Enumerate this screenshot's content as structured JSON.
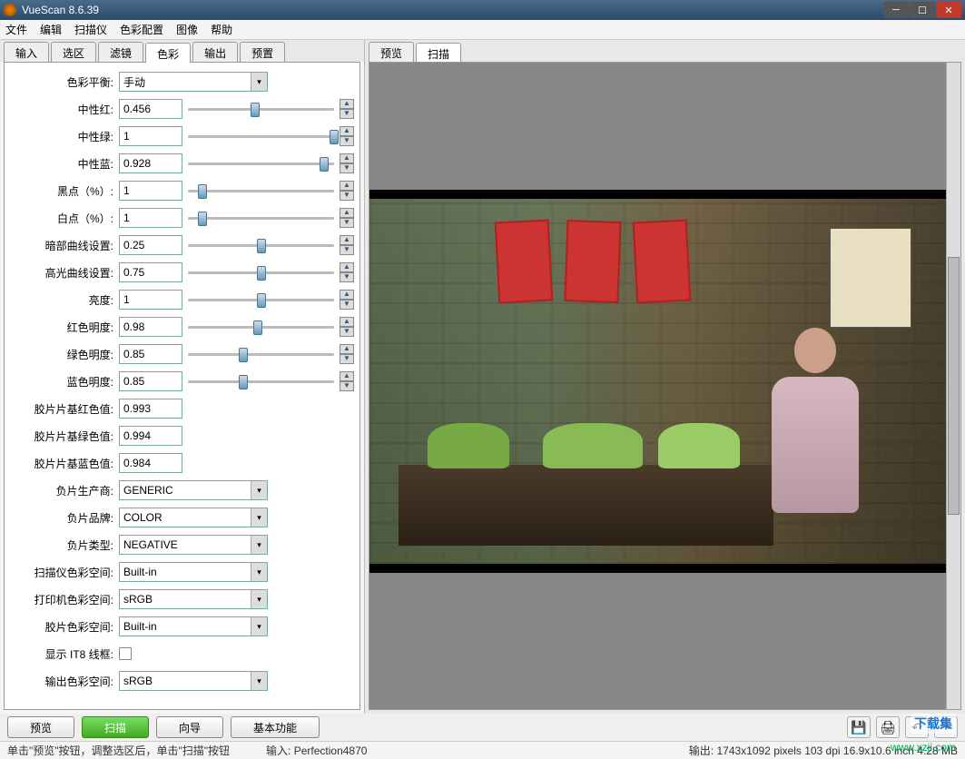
{
  "title": "VueScan 8.6.39",
  "menu": [
    "文件",
    "编辑",
    "扫描仪",
    "色彩配置",
    "图像",
    "帮助"
  ],
  "left_tabs": [
    "输入",
    "选区",
    "滤镜",
    "色彩",
    "输出",
    "预置"
  ],
  "left_active": 3,
  "right_tabs": [
    "预览",
    "扫描"
  ],
  "right_active": 1,
  "color_balance": {
    "label": "色彩平衡:",
    "value": "手动"
  },
  "sliders": [
    {
      "label": "中性红:",
      "value": "0.456",
      "pos": 46
    },
    {
      "label": "中性绿:",
      "value": "1",
      "pos": 100
    },
    {
      "label": "中性蓝:",
      "value": "0.928",
      "pos": 93
    },
    {
      "label": "黑点（%）:",
      "value": "1",
      "pos": 10
    },
    {
      "label": "白点（%）:",
      "value": "1",
      "pos": 10
    },
    {
      "label": "暗部曲线设置:",
      "value": "0.25",
      "pos": 50
    },
    {
      "label": "高光曲线设置:",
      "value": "0.75",
      "pos": 50
    },
    {
      "label": "亮度:",
      "value": "1",
      "pos": 50
    },
    {
      "label": "红色明度:",
      "value": "0.98",
      "pos": 48
    },
    {
      "label": "绿色明度:",
      "value": "0.85",
      "pos": 38
    },
    {
      "label": "蓝色明度:",
      "value": "0.85",
      "pos": 38
    }
  ],
  "film_fields": [
    {
      "label": "胶片片基红色值:",
      "value": "0.993"
    },
    {
      "label": "胶片片基绿色值:",
      "value": "0.994"
    },
    {
      "label": "胶片片基蓝色值:",
      "value": "0.984"
    }
  ],
  "dropdowns": [
    {
      "label": "负片生产商:",
      "value": "GENERIC"
    },
    {
      "label": "负片品牌:",
      "value": "COLOR"
    },
    {
      "label": "负片类型:",
      "value": "NEGATIVE"
    },
    {
      "label": "扫描仪色彩空间:",
      "value": "Built-in"
    },
    {
      "label": "打印机色彩空间:",
      "value": "sRGB"
    },
    {
      "label": "胶片色彩空间:",
      "value": "Built-in"
    }
  ],
  "checkbox": {
    "label": "显示 IT8 线框:"
  },
  "lastrow": {
    "label": "输出色彩空间:",
    "value": "sRGB"
  },
  "buttons": {
    "preview": "预览",
    "scan": "扫描",
    "guide": "向导",
    "basic": "基本功能"
  },
  "status": {
    "hint": "单击\"预览\"按钮，调整选区后，单击\"扫描\"按钮",
    "input": "输入: Perfection4870",
    "output": "输出: 1743x1092 pixels 103 dpi 16.9x10.6 inch 4.28 MB"
  },
  "watermark": "下载集",
  "watermark_url": "www.xzji.com"
}
